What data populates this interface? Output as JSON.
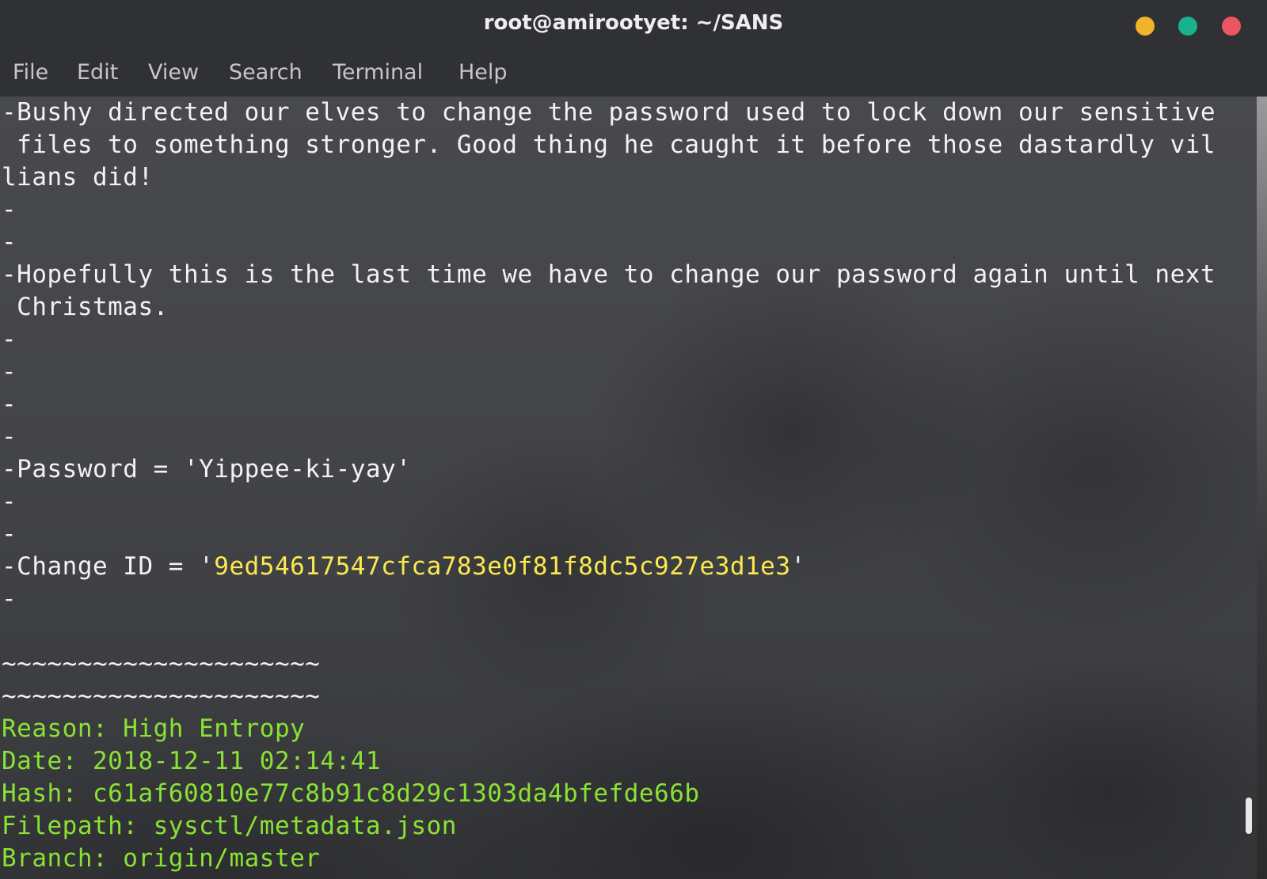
{
  "window": {
    "title": "root@amirootyet: ~/SANS"
  },
  "menu": {
    "items": [
      "File",
      "Edit",
      "View",
      "Search",
      "Terminal",
      "Help"
    ]
  },
  "terminal": {
    "lines": [
      "-Bushy directed our elves to change the password used to lock down our sensitive",
      " files to something stronger. Good thing he caught it before those dastardly vil",
      "lians did!",
      "-",
      "-",
      "-Hopefully this is the last time we have to change our password again until next",
      " Christmas.",
      "-",
      "-",
      "-",
      "-",
      "-Password = 'Yippee-ki-yay'",
      "-",
      "-",
      "-",
      "",
      "~~~~~~~~~~~~~~~~~~~~~",
      "~~~~~~~~~~~~~~~~~~~~~",
      "Reason: High Entropy",
      "Date: 2018-12-11 02:14:41",
      "Hash: c61af60810e77c8b91c8d29c1303da4bfefde66b",
      "Filepath: sysctl/metadata.json",
      "Branch: origin/master"
    ],
    "change_id_prefix": "-Change ID = '",
    "change_id_value": "9ed54617547cfca783e0f81f8dc5c927e3d1e3",
    "change_id_suffix": "'"
  },
  "colors": {
    "text": "#f2f2f2",
    "green": "#8ae234",
    "yellow": "#fce94f",
    "minimize": "#f0b32c",
    "maximize": "#19b28e",
    "close": "#ec5663"
  },
  "icons": {
    "minimize": "minimize-icon",
    "maximize": "maximize-icon",
    "close": "close-icon"
  }
}
